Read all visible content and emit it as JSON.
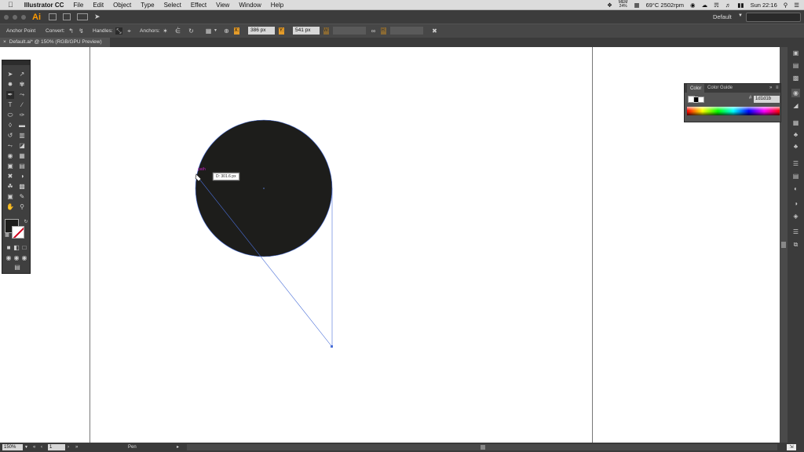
{
  "menubar": {
    "app_name": "Illustrator CC",
    "items": [
      "File",
      "Edit",
      "Object",
      "Type",
      "Select",
      "Effect",
      "View",
      "Window",
      "Help"
    ],
    "status": {
      "mem_label": "MEM",
      "mem_value": "24%",
      "temp_rpm": "69°C 2502rpm",
      "clock": "Sun 22:16"
    }
  },
  "appbar": {
    "logo": "Ai",
    "workspace": "Default"
  },
  "controlbar": {
    "selection_label": "Anchor Point",
    "convert_label": "Convert:",
    "handles_label": "Handles:",
    "anchors_label": "Anchors:",
    "x_label": "X:",
    "x_value": "386 px",
    "y_label": "Y:",
    "y_value": "541 px",
    "w_label": "W:",
    "h_label": "H:"
  },
  "document": {
    "tab_title": "Default.ai* @ 150% (RGB/GPU Preview)"
  },
  "canvas": {
    "tooltip_text": "D: 301.6 px",
    "anchor_label": "path",
    "fill_color": "#1d1d1b",
    "path_color": "#4a6fd8"
  },
  "color_panel": {
    "tab_color": "Color",
    "tab_guide": "Color Guide",
    "hex_symbol": "#",
    "hex_value": "1d1d1b"
  },
  "statusbar": {
    "zoom": "150%",
    "artboard": "1",
    "current_tool": "Pen"
  },
  "icons": {
    "tools": [
      "selection",
      "direct-selection",
      "magic-wand",
      "lasso",
      "pen",
      "curvature",
      "type",
      "line-segment",
      "ellipse",
      "paintbrush",
      "shaper",
      "eraser",
      "rotate",
      "scale",
      "width",
      "free-transform",
      "shape-builder",
      "perspective-grid",
      "mesh",
      "gradient",
      "eyedropper",
      "blend",
      "symbol-sprayer",
      "column-graph",
      "artboard",
      "slice",
      "hand",
      "zoom"
    ]
  }
}
